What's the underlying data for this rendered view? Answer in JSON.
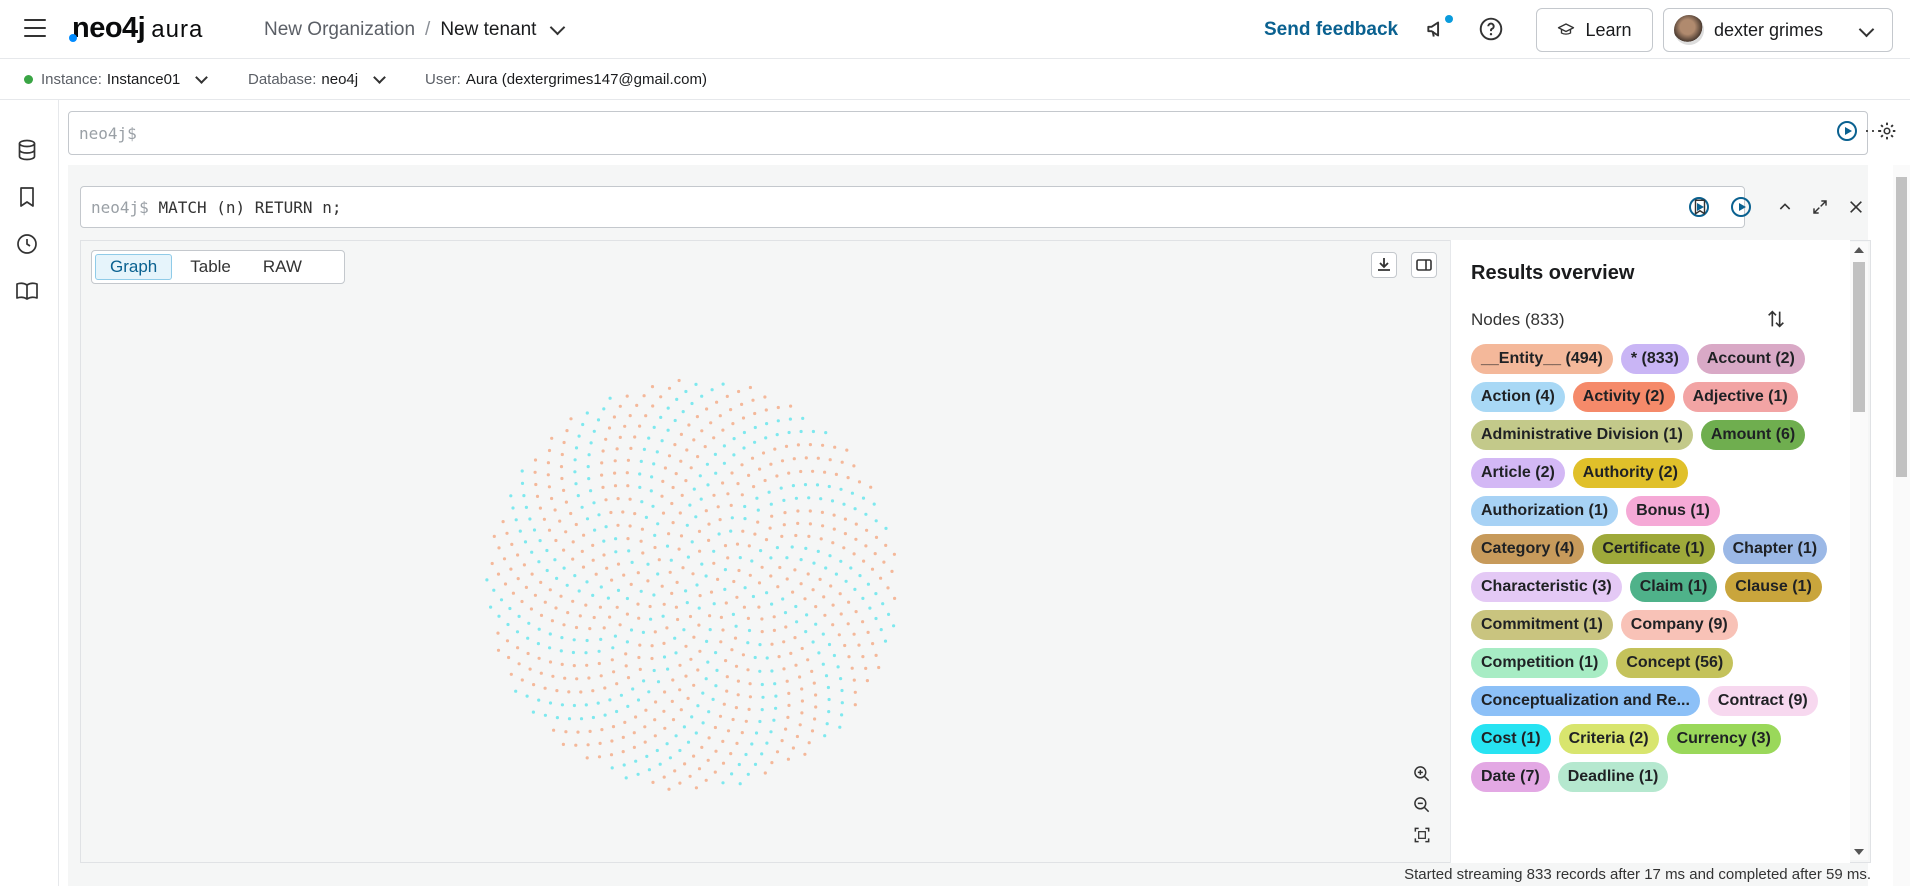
{
  "topbar": {
    "logo_neo": "neo4j",
    "logo_aura": "aura",
    "org": "New Organization",
    "separator": "/",
    "tenant": "New tenant",
    "feedback": "Send feedback",
    "learn": "Learn",
    "user": "dexter grimes"
  },
  "infobar": {
    "instance_label": "Instance:",
    "instance_value": "Instance01",
    "database_label": "Database:",
    "database_value": "neo4j",
    "user_label": "User:",
    "user_value": "Aura (dextergrimes147@gmail.com)"
  },
  "editor": {
    "prompt": "neo4j$",
    "more": "···"
  },
  "frame": {
    "prompt": "neo4j$",
    "query": "MATCH (n) RETURN n;"
  },
  "tabs": [
    {
      "label": "Graph",
      "active": true
    },
    {
      "label": "Table",
      "active": false
    },
    {
      "label": "RAW",
      "active": false
    }
  ],
  "results": {
    "title": "Results overview",
    "nodes_heading": "Nodes (833)",
    "chips": [
      {
        "label": "__Entity__ (494)",
        "color": "#f4b89a"
      },
      {
        "label": "* (833)",
        "color": "#c9b5f5"
      },
      {
        "label": "Account (2)",
        "color": "#d9a9c6"
      },
      {
        "label": "Action (4)",
        "color": "#a8d8f5"
      },
      {
        "label": "Activity (2)",
        "color": "#f58a6a"
      },
      {
        "label": "Adjective (1)",
        "color": "#f2a4a4"
      },
      {
        "label": "Administrative Division (1)",
        "color": "#c3c98a"
      },
      {
        "label": "Amount (6)",
        "color": "#6fae4f"
      },
      {
        "label": "Article (2)",
        "color": "#d3b8f5"
      },
      {
        "label": "Authority (2)",
        "color": "#e0c02a"
      },
      {
        "label": "Authorization (1)",
        "color": "#a7d2f5"
      },
      {
        "label": "Bonus (1)",
        "color": "#f5a9d6"
      },
      {
        "label": "Category (4)",
        "color": "#c79a5b"
      },
      {
        "label": "Certificate (1)",
        "color": "#9ea93a"
      },
      {
        "label": "Chapter (1)",
        "color": "#9bb8e6"
      },
      {
        "label": "Characteristic (3)",
        "color": "#e4c9f5"
      },
      {
        "label": "Claim (1)",
        "color": "#4fb28a"
      },
      {
        "label": "Clause (1)",
        "color": "#c9a53c"
      },
      {
        "label": "Commitment (1)",
        "color": "#c9c47f"
      },
      {
        "label": "Company (9)",
        "color": "#f8c2b7"
      },
      {
        "label": "Competition (1)",
        "color": "#a7ecc4"
      },
      {
        "label": "Concept (56)",
        "color": "#c4c25b"
      },
      {
        "label": "Conceptualization and Re...",
        "color": "#8cc0f7"
      },
      {
        "label": "Contract (9)",
        "color": "#f7d8ef"
      },
      {
        "label": "Cost (1)",
        "color": "#27e3f2"
      },
      {
        "label": "Criteria (2)",
        "color": "#d8e56e"
      },
      {
        "label": "Currency (3)",
        "color": "#9ad85a"
      },
      {
        "label": "Date (7)",
        "color": "#e3a8e4"
      },
      {
        "label": "Deadline (1)",
        "color": "#b5e8cf"
      }
    ]
  },
  "graph": {
    "node_count": 833,
    "colors": [
      "#f4b89a",
      "#7ee8ee"
    ]
  },
  "status": "Started streaming 833 records after 17 ms and completed after 59 ms.",
  "icons": {
    "menu": "hamburger-icon",
    "announce": "megaphone-icon",
    "help": "help-icon",
    "learn": "graduation-cap-icon",
    "settings": "gear-icon"
  }
}
